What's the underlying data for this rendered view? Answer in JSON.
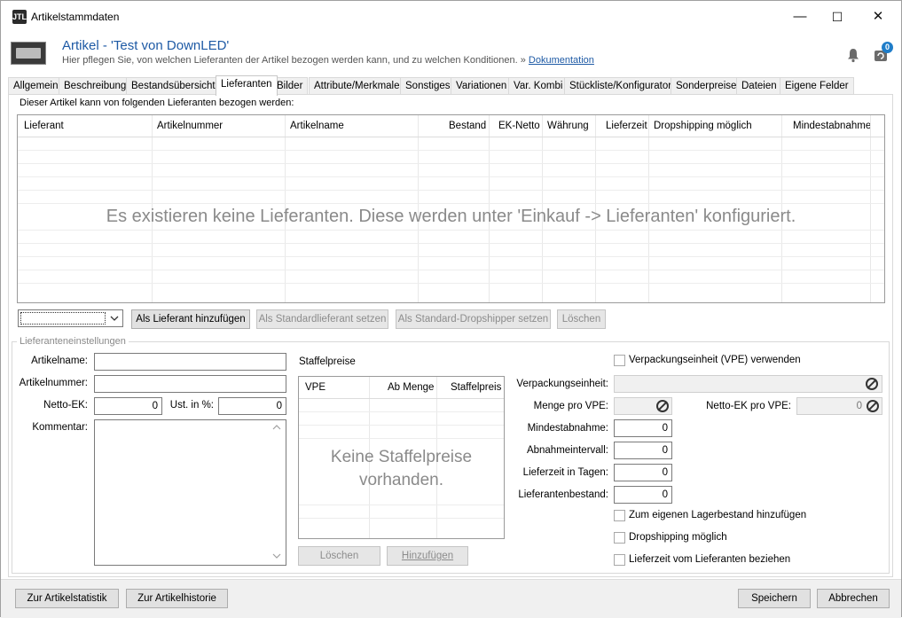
{
  "window": {
    "title": "Artikelstammdaten",
    "minimize": "—",
    "maximize": "☐",
    "close": "✕"
  },
  "header": {
    "title": "Artikel - 'Test von DownLED'",
    "subtitle": "Hier pflegen Sie, von welchen Lieferanten der Artikel bezogen werden kann, und zu welchen Konditionen.",
    "doc_arrow": "»",
    "doc_link": "Dokumentation",
    "notification_count": "0",
    "app_icon_text": "JTL"
  },
  "tabs": [
    {
      "label": "Allgemein"
    },
    {
      "label": "Beschreibung"
    },
    {
      "label": "Bestandsübersicht"
    },
    {
      "label": "Lieferanten"
    },
    {
      "label": "Bilder"
    },
    {
      "label": "Attribute/Merkmale"
    },
    {
      "label": "Sonstiges"
    },
    {
      "label": "Variationen"
    },
    {
      "label": "Var. Kombi"
    },
    {
      "label": "Stückliste/Konfigurator"
    },
    {
      "label": "Sonderpreise"
    },
    {
      "label": "Dateien"
    },
    {
      "label": "Eigene Felder"
    }
  ],
  "active_tab": "Lieferanten",
  "suppliers": {
    "caption": "Dieser Artikel kann von folgenden Lieferanten bezogen werden:",
    "columns": [
      "Lieferant",
      "Artikelnummer",
      "Artikelname",
      "Bestand",
      "EK-Netto",
      "Währung",
      "Lieferzeit",
      "Dropshipping möglich",
      "Mindestabnahme"
    ],
    "empty_message": "Es existieren keine Lieferanten. Diese werden unter 'Einkauf -> Lieferanten' konfiguriert.",
    "combo_value": "",
    "buttons": {
      "add": "Als Lieferant hinzufügen",
      "set_standard": "Als Standardlieferant setzen",
      "set_dropshipper": "Als Standard-Dropshipper setzen",
      "delete": "Löschen"
    }
  },
  "settings": {
    "group_title": "Lieferanteneinstellungen",
    "artikelname_label": "Artikelname:",
    "artikelname_value": "",
    "artikelnummer_label": "Artikelnummer:",
    "artikelnummer_value": "",
    "netto_ek_label": "Netto-EK:",
    "netto_ek_value": "0",
    "ust_label": "Ust. in %:",
    "ust_value": "0",
    "kommentar_label": "Kommentar:",
    "kommentar_value": ""
  },
  "staffel": {
    "title": "Staffelpreise",
    "columns": [
      "VPE",
      "Ab Menge",
      "Staffelpreis"
    ],
    "empty_line1": "Keine Staffelpreise",
    "empty_line2": "vorhanden.",
    "delete_button": "Löschen",
    "add_button": "Hinzufügen"
  },
  "vpe": {
    "use_vpe_label": "Verpackungseinheit (VPE) verwenden",
    "use_vpe_checked": false,
    "verpackungseinheit_label": "Verpackungseinheit:",
    "menge_label": "Menge pro VPE:",
    "netto_ek_vpe_label": "Netto-EK pro VPE:",
    "netto_ek_vpe_value": "0",
    "mindestabnahme_label": "Mindestabnahme:",
    "mindestabnahme_value": "0",
    "abnahmeintervall_label": "Abnahmeintervall:",
    "abnahmeintervall_value": "0",
    "lieferzeit_label": "Lieferzeit in Tagen:",
    "lieferzeit_value": "0",
    "lieferantenbestand_label": "Lieferantenbestand:",
    "lieferantenbestand_value": "0",
    "lagerbestand_label": "Zum eigenen Lagerbestand hinzufügen",
    "dropshipping_label": "Dropshipping möglich",
    "lieferzeit_lieferant_label": "Lieferzeit vom Lieferanten beziehen"
  },
  "footer": {
    "statistik_button": "Zur Artikelstatistik",
    "historie_button": "Zur Artikelhistorie",
    "save_button": "Speichern",
    "cancel_button": "Abbrechen"
  },
  "icons": {
    "bell": "bell-icon",
    "refresh": "refresh-icon",
    "no_entry": "no-entry-icon",
    "dropdown": "chevron-down-icon",
    "scroll_up": "scroll-up-icon",
    "scroll_down": "scroll-down-icon"
  },
  "colors": {
    "accent": "#1e5aa5",
    "badge": "#1f7dc9",
    "empty_text": "#8a8a8a"
  }
}
